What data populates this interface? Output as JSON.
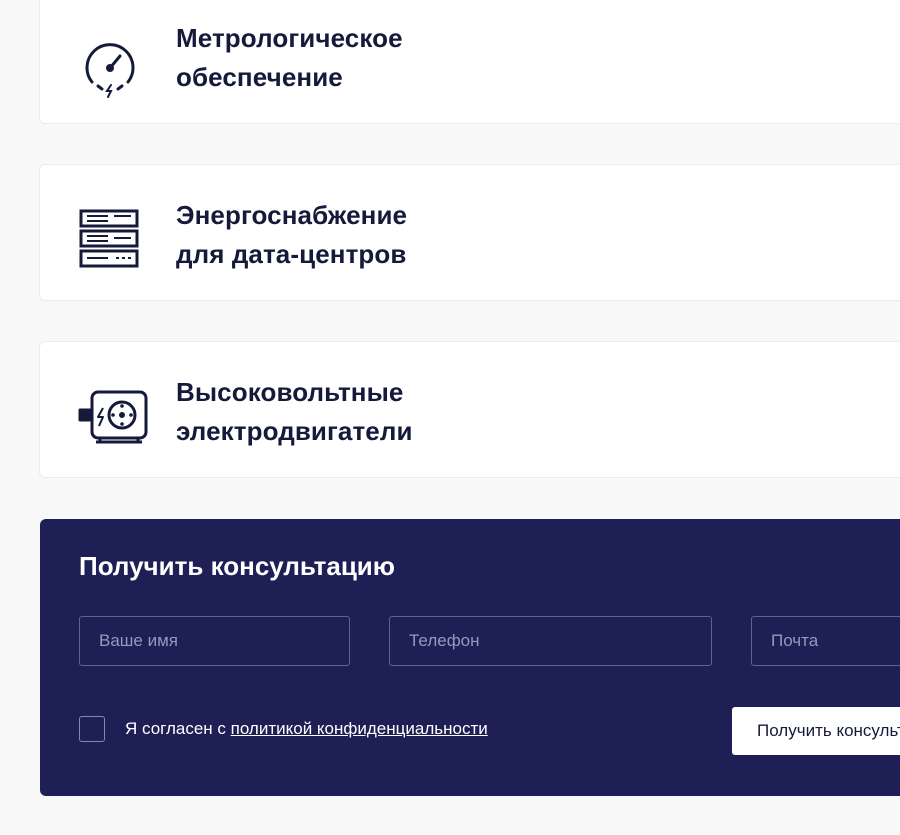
{
  "services": [
    {
      "icon": "gauge-icon",
      "line1": "Метрологическое",
      "line2": "обеспечение"
    },
    {
      "icon": "server-rack-icon",
      "line1": "Энергоснабжение",
      "line2": "для дата-центров"
    },
    {
      "icon": "electric-motor-icon",
      "line1": "Высоковольтные",
      "line2": "электродвигатели"
    }
  ],
  "consultation": {
    "title": "Получить консультацию",
    "name_placeholder": "Ваше имя",
    "phone_placeholder": "Телефон",
    "email_placeholder": "Почта",
    "consent_prefix": "Я согласен с ",
    "consent_link": "политикой конфиденциальности",
    "submit_label": "Получить консультацию"
  },
  "colors": {
    "form_background": "#1d1f55",
    "title_text": "#151a3a",
    "page_background": "#f8f8f9"
  }
}
